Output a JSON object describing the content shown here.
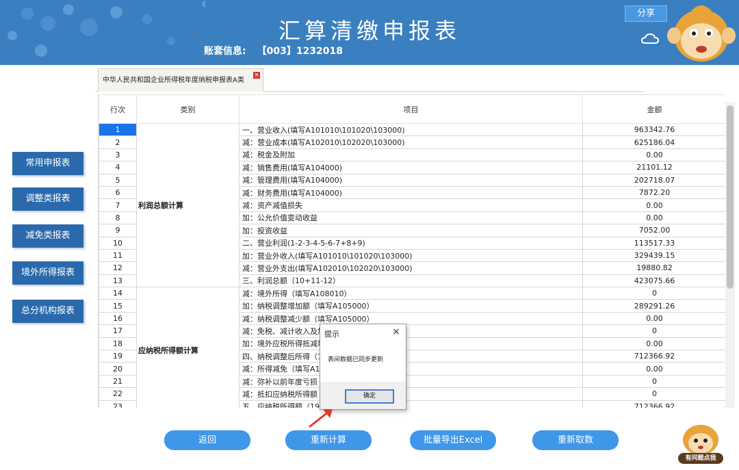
{
  "header": {
    "title": "汇算清缴申报表",
    "account_label": "账套信息:",
    "account_value": "【003】1232018",
    "share_label": "分享"
  },
  "tab": {
    "label": "中华人民共和国企业所得税年度纳税申报表A类",
    "close": "×"
  },
  "sidebar": [
    {
      "label": "常用申报表"
    },
    {
      "label": "调整类报表"
    },
    {
      "label": "减免类报表"
    },
    {
      "label": "境外所得报表"
    },
    {
      "label": "总分机构报表"
    }
  ],
  "grid": {
    "headers": [
      "行次",
      "类别",
      "项目",
      "金额"
    ],
    "category1": "利润总额计算",
    "category2": "应纳税所得额计算",
    "rows": [
      {
        "no": "1",
        "item": "一、营业收入(填写A101010\\101020\\103000)",
        "amount": "963342.76"
      },
      {
        "no": "2",
        "item": "减：营业成本(填写A102010\\102020\\103000)",
        "amount": "625186.04"
      },
      {
        "no": "3",
        "item": "减：税金及附加",
        "amount": "0.00"
      },
      {
        "no": "4",
        "item": "减：销售费用(填写A104000)",
        "amount": "21101.12"
      },
      {
        "no": "5",
        "item": "减：管理费用(填写A104000)",
        "amount": "202718.07"
      },
      {
        "no": "6",
        "item": "减：财务费用(填写A104000)",
        "amount": "7872.20"
      },
      {
        "no": "7",
        "item": "减：资产减值损失",
        "amount": "0.00"
      },
      {
        "no": "8",
        "item": "加：公允价值变动收益",
        "amount": "0.00"
      },
      {
        "no": "9",
        "item": "加：投资收益",
        "amount": "7052.00"
      },
      {
        "no": "10",
        "item": "二、营业利润(1-2-3-4-5-6-7+8+9)",
        "amount": "113517.33"
      },
      {
        "no": "11",
        "item": "加：营业外收入(填写A101010\\101020\\103000)",
        "amount": "329439.15"
      },
      {
        "no": "12",
        "item": "减：营业外支出(填写A102010\\102020\\103000)",
        "amount": "19880.82"
      },
      {
        "no": "13",
        "item": "三、利润总额（10+11-12）",
        "amount": "423075.66"
      },
      {
        "no": "14",
        "item": "减：境外所得（填写A108010）",
        "amount": "0"
      },
      {
        "no": "15",
        "item": "加：纳税调整增加额（填写A105000）",
        "amount": "289291.26"
      },
      {
        "no": "16",
        "item": "减：纳税调整减少额（填写A105000）",
        "amount": "0.00"
      },
      {
        "no": "17",
        "item": "减：免税、减计收入及加",
        "amount": "0"
      },
      {
        "no": "18",
        "item": "加：境外应税所得抵减境",
        "amount": "0.00"
      },
      {
        "no": "19",
        "item": "四、纳税调整后所得（1",
        "amount": "712366.92"
      },
      {
        "no": "20",
        "item": "减：所得减免（填写A10",
        "amount": "0.00"
      },
      {
        "no": "21",
        "item": "减：弥补以前年度亏损",
        "amount": "0"
      },
      {
        "no": "22",
        "item": "减：抵扣应纳税所得额",
        "amount": "0"
      },
      {
        "no": "23",
        "item": "五、应纳税所得额（19-",
        "amount": "712366.92"
      }
    ]
  },
  "dialog": {
    "title": "提示",
    "message": "表间数据已同步更新",
    "ok": "确定",
    "close": "×"
  },
  "actions": {
    "back": "返回",
    "recalc": "重新计算",
    "export": "批量导出Excel",
    "refetch": "重新取数"
  },
  "help": {
    "label": "有问题点我"
  },
  "colors": {
    "header_bg": "#3a7fc0",
    "side_button": "#2a6aac",
    "action_button": "#3f97ea",
    "selected_row": "#1a73e8"
  }
}
